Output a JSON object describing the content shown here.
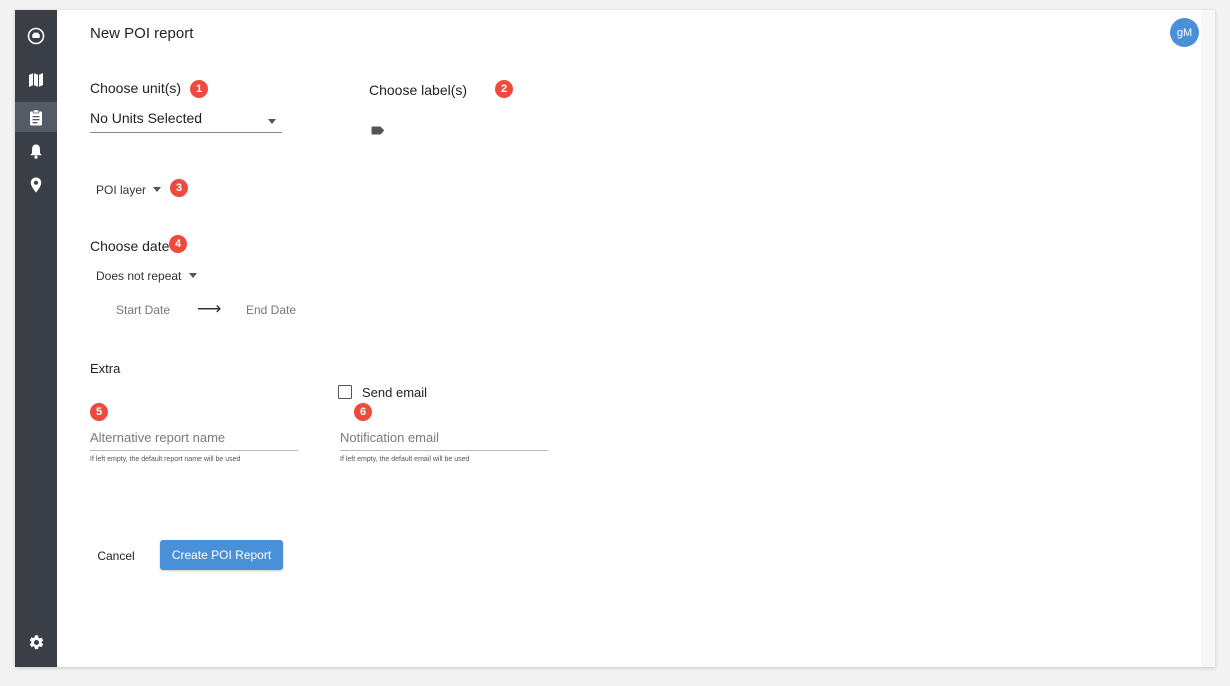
{
  "header": {
    "title": "New POI report",
    "avatar_initials": "gM"
  },
  "sidebar": {
    "items": [
      {
        "icon": "car-icon",
        "active": false
      },
      {
        "icon": "map-icon",
        "active": false
      },
      {
        "icon": "clipboard-icon",
        "active": true
      },
      {
        "icon": "bell-icon",
        "active": false
      },
      {
        "icon": "map-pin-icon",
        "active": false
      },
      {
        "icon": "gear-icon",
        "active": false
      }
    ]
  },
  "units": {
    "label": "Choose unit(s)",
    "badge": "1",
    "selected": "No Units Selected"
  },
  "labels": {
    "label": "Choose label(s)",
    "badge": "2",
    "icon": "tag-icon"
  },
  "poi_layer": {
    "label": "POI layer",
    "badge": "3"
  },
  "date": {
    "label": "Choose date",
    "badge": "4",
    "repeat": "Does not repeat",
    "start": "Start Date",
    "arrow": "⟶",
    "end": "End Date"
  },
  "extra": {
    "label": "Extra",
    "report_name": {
      "badge": "5",
      "placeholder": "Alternative report name",
      "value": "",
      "helper": "If left empty, the default report name will be used"
    },
    "send_email": {
      "label": "Send email",
      "checked": false
    },
    "notification": {
      "badge": "6",
      "placeholder": "Notification email",
      "value": "",
      "helper": "If left empty, the default email will be used"
    }
  },
  "actions": {
    "cancel": "Cancel",
    "create": "Create POI Report"
  },
  "colors": {
    "sidebar": "#3a3f47",
    "accent": "#4a90d9",
    "badge": "#ee4a3f"
  }
}
